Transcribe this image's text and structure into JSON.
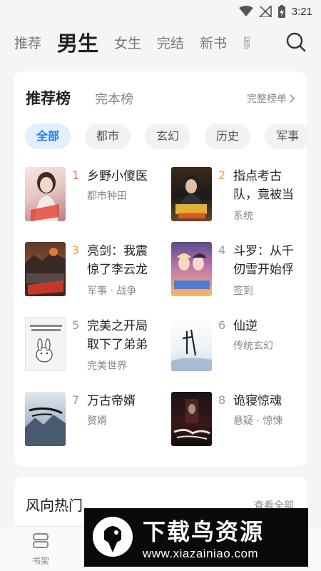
{
  "status_bar": {
    "time": "3:21"
  },
  "top_tabs": [
    {
      "label": "推荐",
      "active": false
    },
    {
      "label": "男生",
      "active": true
    },
    {
      "label": "女生",
      "active": false
    },
    {
      "label": "完结",
      "active": false
    },
    {
      "label": "新书",
      "active": false
    },
    {
      "label": "影",
      "active": false
    }
  ],
  "ranking": {
    "title": "推荐榜",
    "alt_tab": "完本榜",
    "more": "完整榜单",
    "chips": [
      "全部",
      "都市",
      "玄幻",
      "历史",
      "军事"
    ],
    "books": [
      {
        "rank": "1",
        "title": "乡野小傻医",
        "tag": "都市种田"
      },
      {
        "rank": "2",
        "title": "指点考古队，竟被当",
        "tag": "系统"
      },
      {
        "rank": "3",
        "title": "亮剑：我震惊了李云龙",
        "tag": "军事 · 战争"
      },
      {
        "rank": "4",
        "title": "斗罗：从千仞雪开始俘",
        "tag": "签到"
      },
      {
        "rank": "5",
        "title": "完美之开局取下了弟弟",
        "tag": "完美世界"
      },
      {
        "rank": "6",
        "title": "仙逆",
        "tag": "传统玄幻"
      },
      {
        "rank": "7",
        "title": "万古帝婿",
        "tag": "赘婿"
      },
      {
        "rank": "8",
        "title": "诡寝惊魂",
        "tag": "悬疑 · 惊悚"
      }
    ]
  },
  "hot_section": {
    "title": "风向热门",
    "more": "查看全部"
  },
  "bottom_nav": {
    "bookshelf": "书架"
  },
  "watermark": {
    "main": "下载鸟资源",
    "url": "www.xiazainiao.com"
  },
  "colors": {
    "accent": "#2a7cf1",
    "rank_top": "#e8705a",
    "rank_gold": "#f0a33a"
  }
}
